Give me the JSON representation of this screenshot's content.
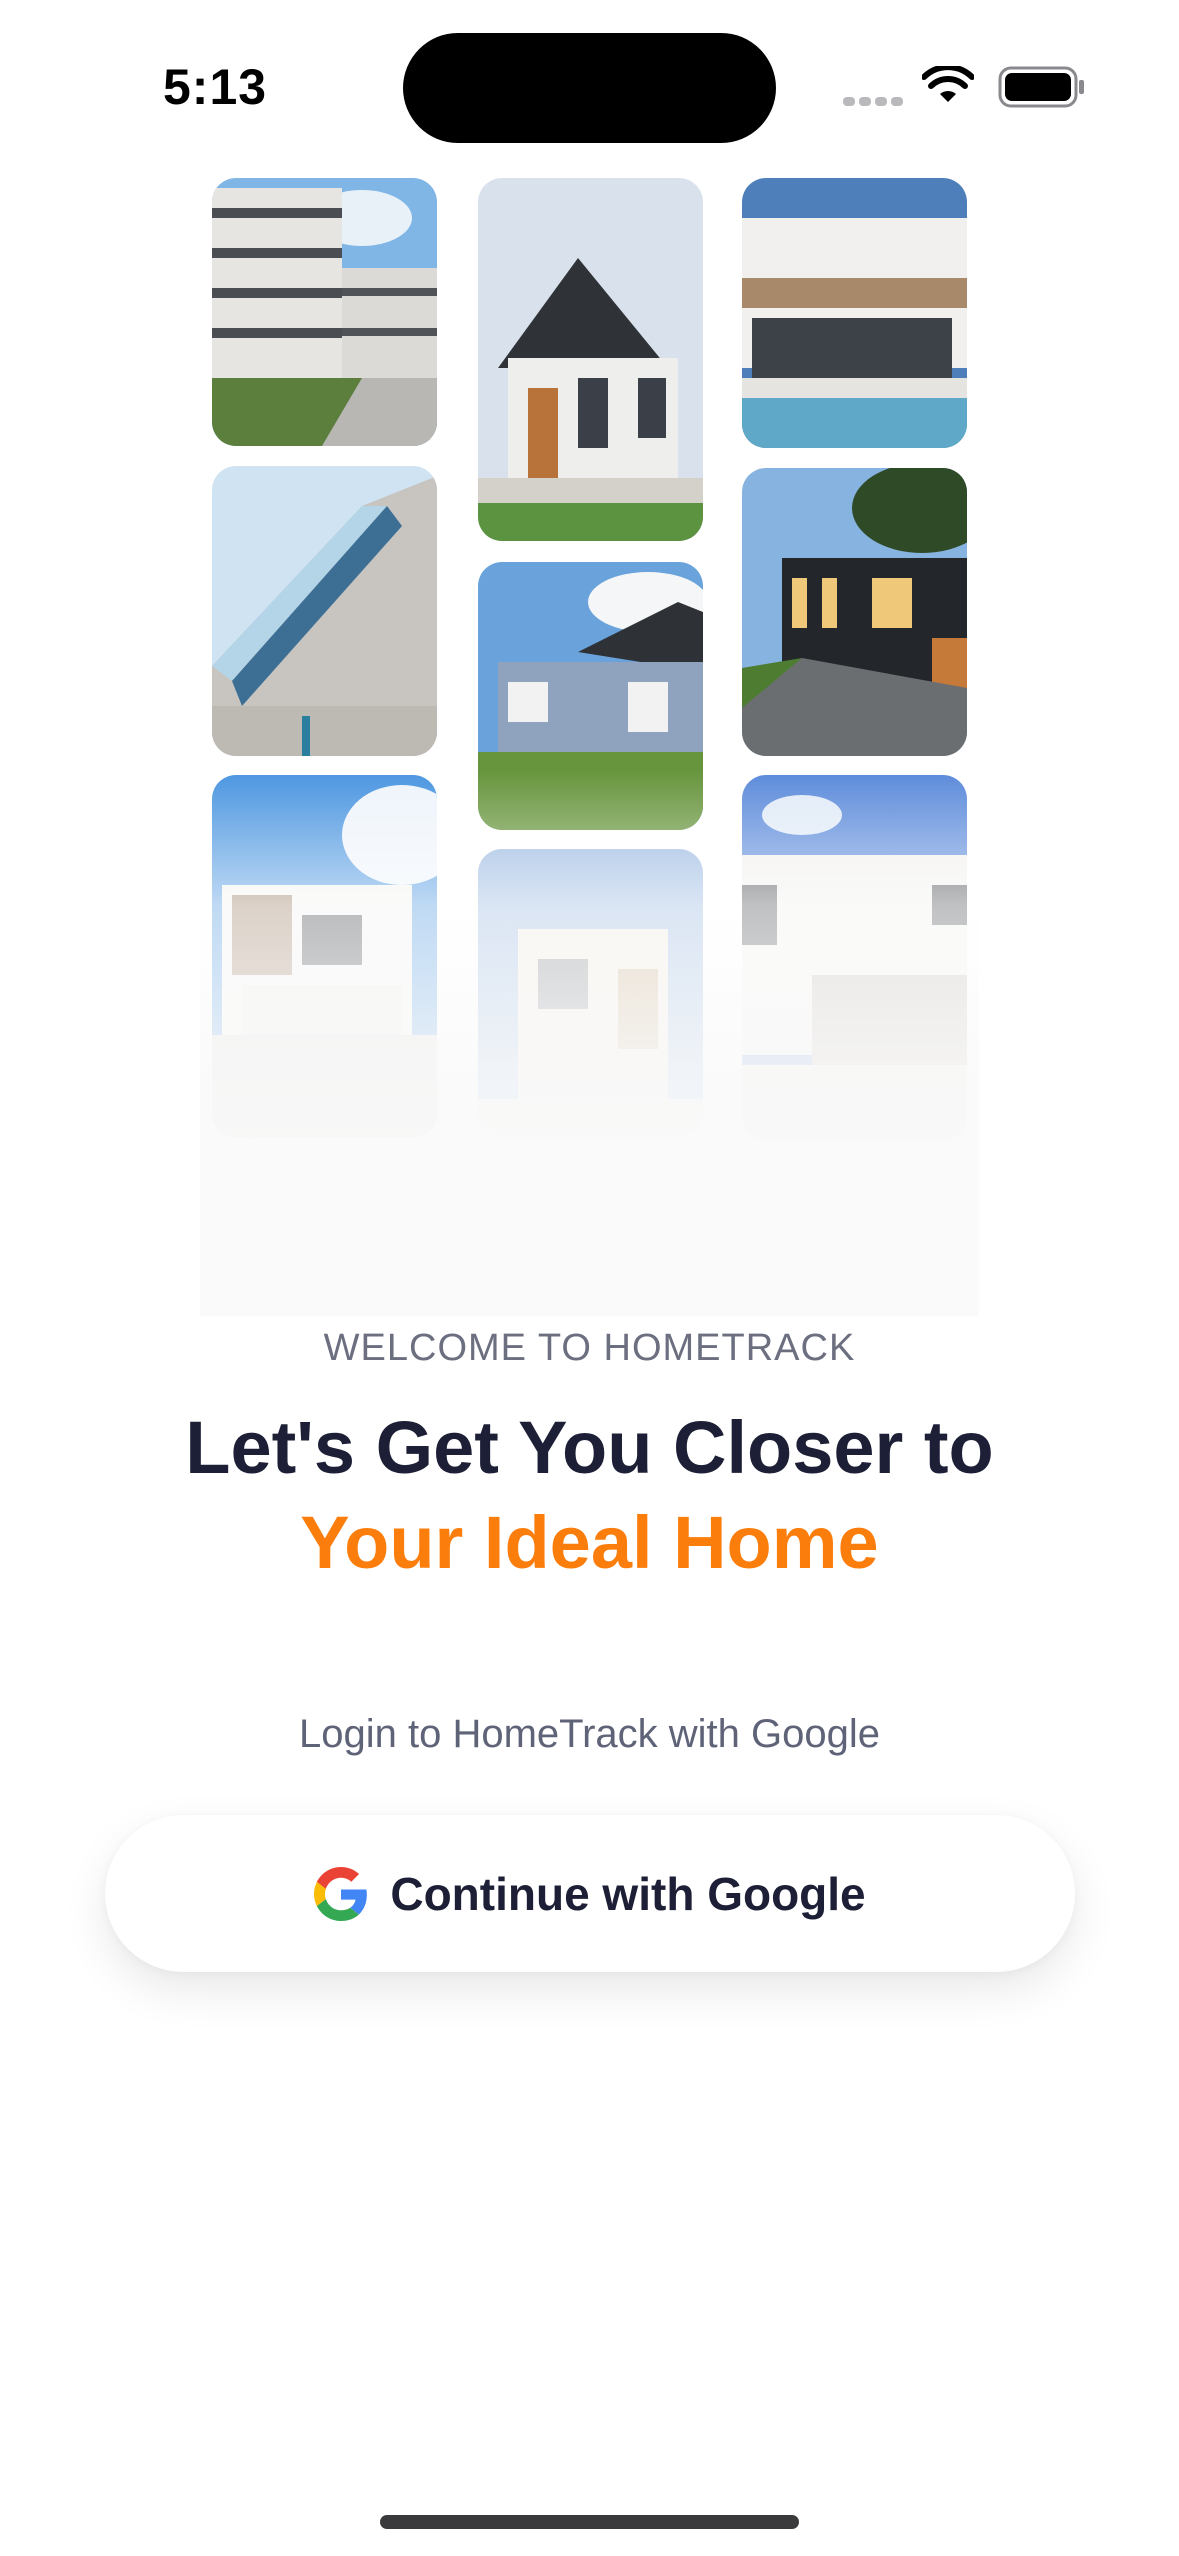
{
  "status_bar": {
    "time": "5:13"
  },
  "intro": {
    "eyebrow": "WELCOME TO HOMETRACK",
    "title_line1": "Let's Get You Closer to",
    "title_line2": "Your Ideal Home",
    "login_hint": "Login to HomeTrack with Google"
  },
  "google_button": {
    "label": "Continue with Google",
    "icon": "google-g-icon"
  },
  "colors": {
    "accent": "#fb7d0b",
    "heading": "#1c1f35",
    "muted": "#6b6f80"
  }
}
